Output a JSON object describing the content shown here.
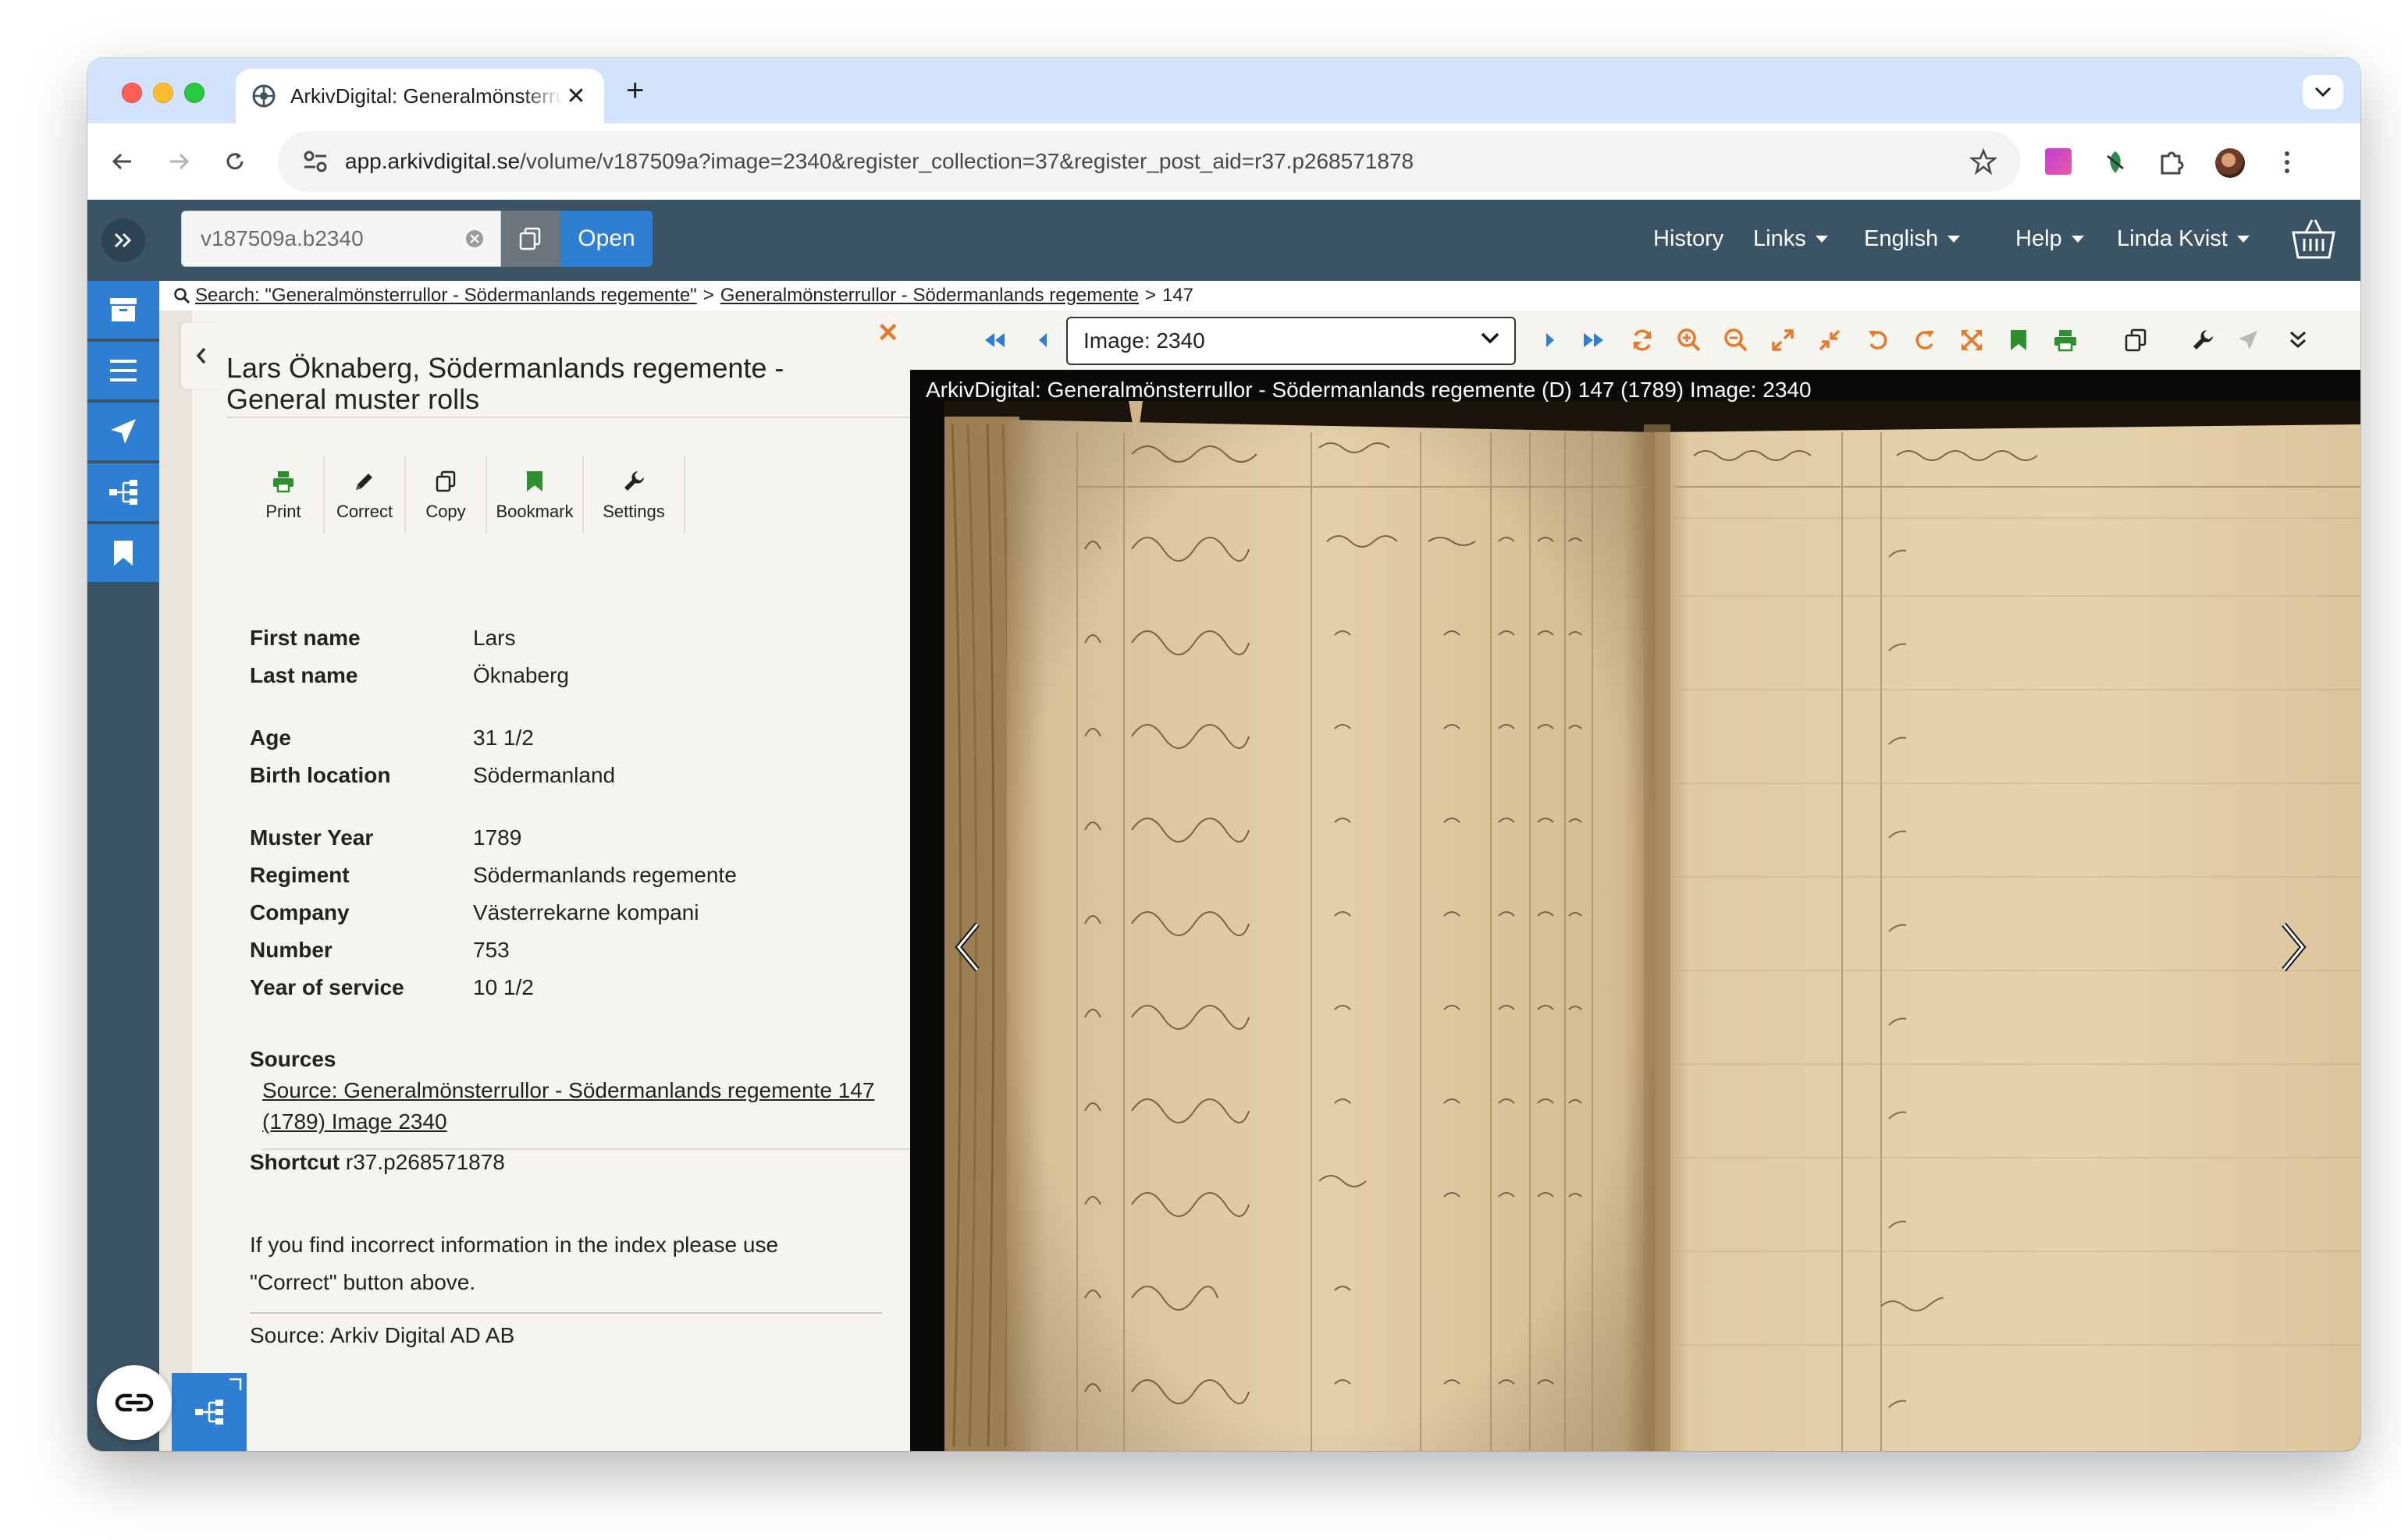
{
  "browser": {
    "tab_title": "ArkivDigital: Generalmönsterrullor",
    "url_host": "app.arkivdigital.se",
    "url_path": "/volume/v187509a?image=2340&register_collection=37&register_post_aid=r37.p268571878"
  },
  "header": {
    "reference_value": "v187509a.b2340",
    "open_label": "Open",
    "nav": {
      "history": "History",
      "links": "Links",
      "language": "English",
      "help": "Help",
      "user": "Linda Kvist"
    }
  },
  "breadcrumb": {
    "search_link": "Search: \"Generalmönsterrullor - Södermanlands regemente\"",
    "collection_link": "Generalmönsterrullor - Södermanlands regemente",
    "current": "147",
    "separator": ">"
  },
  "detail": {
    "title": "Lars Öknaberg, Södermanlands regemente - General muster rolls",
    "actions": {
      "print": "Print",
      "correct": "Correct",
      "copy": "Copy",
      "bookmark": "Bookmark",
      "settings": "Settings"
    },
    "fields": [
      {
        "label": "First name",
        "value": "Lars"
      },
      {
        "label": "Last name",
        "value": "Öknaberg"
      },
      {
        "label": "Age",
        "value": "31 1/2"
      },
      {
        "label": "Birth location",
        "value": "Södermanland"
      },
      {
        "label": "Muster Year",
        "value": "1789"
      },
      {
        "label": "Regiment",
        "value": "Södermanlands regemente"
      },
      {
        "label": "Company",
        "value": "Västerrekarne kompani"
      },
      {
        "label": "Number",
        "value": "753"
      },
      {
        "label": "Year of service",
        "value": "10 1/2"
      }
    ],
    "sources_heading": "Sources",
    "source_link": "Source: Generalmönsterrullor - Södermanlands regemente 147 (1789) Image 2340",
    "shortcut_label": "Shortcut",
    "shortcut_value": "r37.p268571878",
    "info_text": "If you find incorrect information in the index please use \"Correct\" button above.",
    "source_credit": "Source: Arkiv Digital AD AB"
  },
  "viewer": {
    "image_select": "Image: 2340",
    "caption": "ArkivDigital: Generalmönsterrullor - Södermanlands regemente (D) 147 (1789) Image: 2340"
  },
  "colors": {
    "header_bg": "#3a5466",
    "accent_blue": "#2e7fd3",
    "accent_orange": "#e8782a",
    "accent_green": "#2f8f2f",
    "panel_bg": "#f6f4ef"
  }
}
